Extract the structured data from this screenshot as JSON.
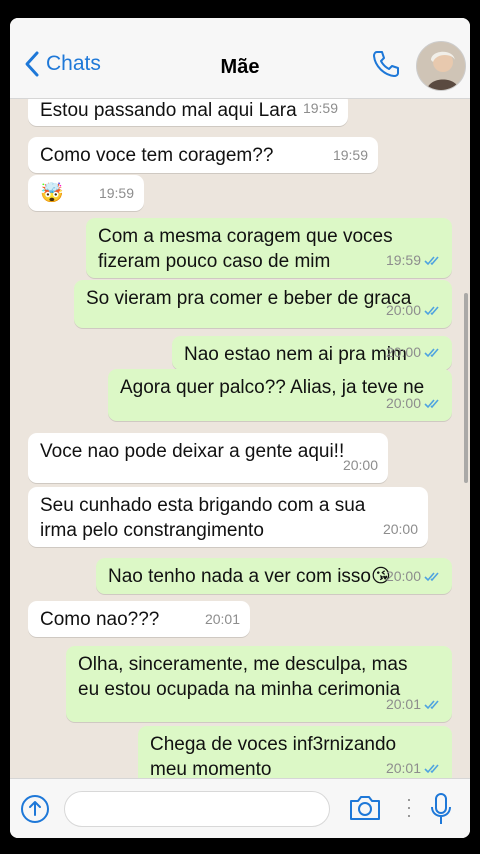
{
  "header": {
    "back_label": "Chats",
    "contact_name": "Mãe",
    "accent": "#1e78d8"
  },
  "messages": [
    {
      "dir": "in",
      "text": "Estou passando mal aqui Lara",
      "time": "19:59"
    },
    {
      "dir": "in",
      "text": "Como voce tem coragem??",
      "time": "19:59"
    },
    {
      "dir": "in",
      "text": "🤯",
      "time": "19:59"
    },
    {
      "dir": "out",
      "text": "Com a mesma coragem que voces\nfizeram pouco caso de mim",
      "time": "19:59",
      "read": true
    },
    {
      "dir": "out",
      "text": "So vieram pra comer e beber de graca",
      "time": "20:00",
      "read": true
    },
    {
      "dir": "out",
      "text": "Nao estao nem ai pra mim",
      "time": "20:00",
      "read": true
    },
    {
      "dir": "out",
      "text": "Agora quer palco?? Alias, ja teve ne",
      "time": "20:00",
      "read": true
    },
    {
      "dir": "in",
      "text": "Voce nao pode deixar a gente aqui!!",
      "time": "20:00"
    },
    {
      "dir": "in",
      "text": "Seu cunhado esta brigando com a sua\nirma pelo constrangimento",
      "time": "20:00"
    },
    {
      "dir": "out",
      "text": "Nao tenho nada a ver com isso😘",
      "time": "20:00",
      "read": true
    },
    {
      "dir": "in",
      "text": "Como nao???",
      "time": "20:01"
    },
    {
      "dir": "out",
      "text": "Olha, sinceramente, me desculpa, mas\neu estou ocupada na minha cerimonia",
      "time": "20:01",
      "read": true
    },
    {
      "dir": "out",
      "text": "Chega de voces inf3rnizando\nmeu momento",
      "time": "20:01",
      "read": true
    }
  ],
  "input": {
    "placeholder": ""
  },
  "colors": {
    "incoming": "#ffffff",
    "outgoing": "#dcf8c6",
    "read_ticks": "#4fa3e0",
    "background": "#ece5dd"
  }
}
